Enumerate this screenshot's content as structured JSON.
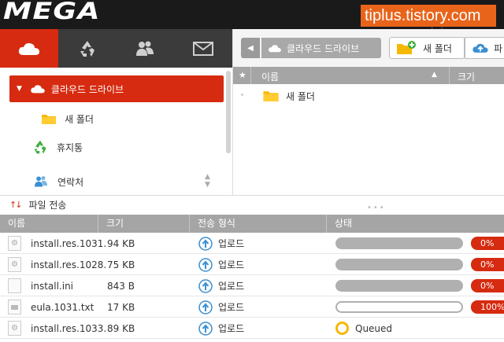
{
  "app": {
    "logo": "MEGA",
    "watermark": "tiplus.tistory.com"
  },
  "colors": {
    "accent": "#d62b10",
    "topbar": "#1a1a1a",
    "tabs_bg": "#3b3b3b",
    "header_gray": "#a5a5a5",
    "folder_yellow": "#f5b800",
    "upload_blue": "#3a8fd1"
  },
  "left_tabs": [
    {
      "icon": "cloud-icon",
      "active": true
    },
    {
      "icon": "recycle-icon",
      "active": false
    },
    {
      "icon": "contacts-icon",
      "active": false
    },
    {
      "icon": "mail-icon",
      "active": false
    }
  ],
  "sidebar": {
    "items": [
      {
        "label": "클라우드 드라이브",
        "icon": "cloud-icon",
        "active": true
      },
      {
        "label": "새 폴더",
        "icon": "folder-icon",
        "active": false
      },
      {
        "label": "휴지통",
        "icon": "recycle-icon",
        "active": false
      },
      {
        "label": "연락처",
        "icon": "contacts-icon",
        "active": false
      }
    ]
  },
  "breadcrumb": {
    "current": "클라우드 드라이브"
  },
  "toolbar": {
    "new_folder_label": "새 폴더",
    "upload_label": "파"
  },
  "file_grid": {
    "columns": {
      "name": "이름",
      "size": "크기"
    },
    "rows": [
      {
        "name": "새 폴더",
        "icon": "folder-icon"
      }
    ]
  },
  "transfers": {
    "title": "파일 전송",
    "columns": {
      "name": "이름",
      "size": "크기",
      "type": "전송 형식",
      "status": "상태"
    },
    "rows": [
      {
        "name": "install.res.1031.",
        "size": "94 KB",
        "type": "업로드",
        "progress": 0,
        "pct": "0%",
        "file_icon": "gear-file-icon",
        "queued": false
      },
      {
        "name": "install.res.1028.",
        "size": "75 KB",
        "type": "업로드",
        "progress": 0,
        "pct": "0%",
        "file_icon": "gear-file-icon",
        "queued": false
      },
      {
        "name": "install.ini",
        "size": "843 B",
        "type": "업로드",
        "progress": 0,
        "pct": "0%",
        "file_icon": "blank-file-icon",
        "queued": false
      },
      {
        "name": "eula.1031.txt",
        "size": "17 KB",
        "type": "업로드",
        "progress": 100,
        "pct": "100%",
        "file_icon": "folder-file-icon",
        "queued": false
      },
      {
        "name": "install.res.1033.",
        "size": "89 KB",
        "type": "업로드",
        "status": "Queued",
        "file_icon": "gear-file-icon",
        "queued": true
      }
    ]
  }
}
